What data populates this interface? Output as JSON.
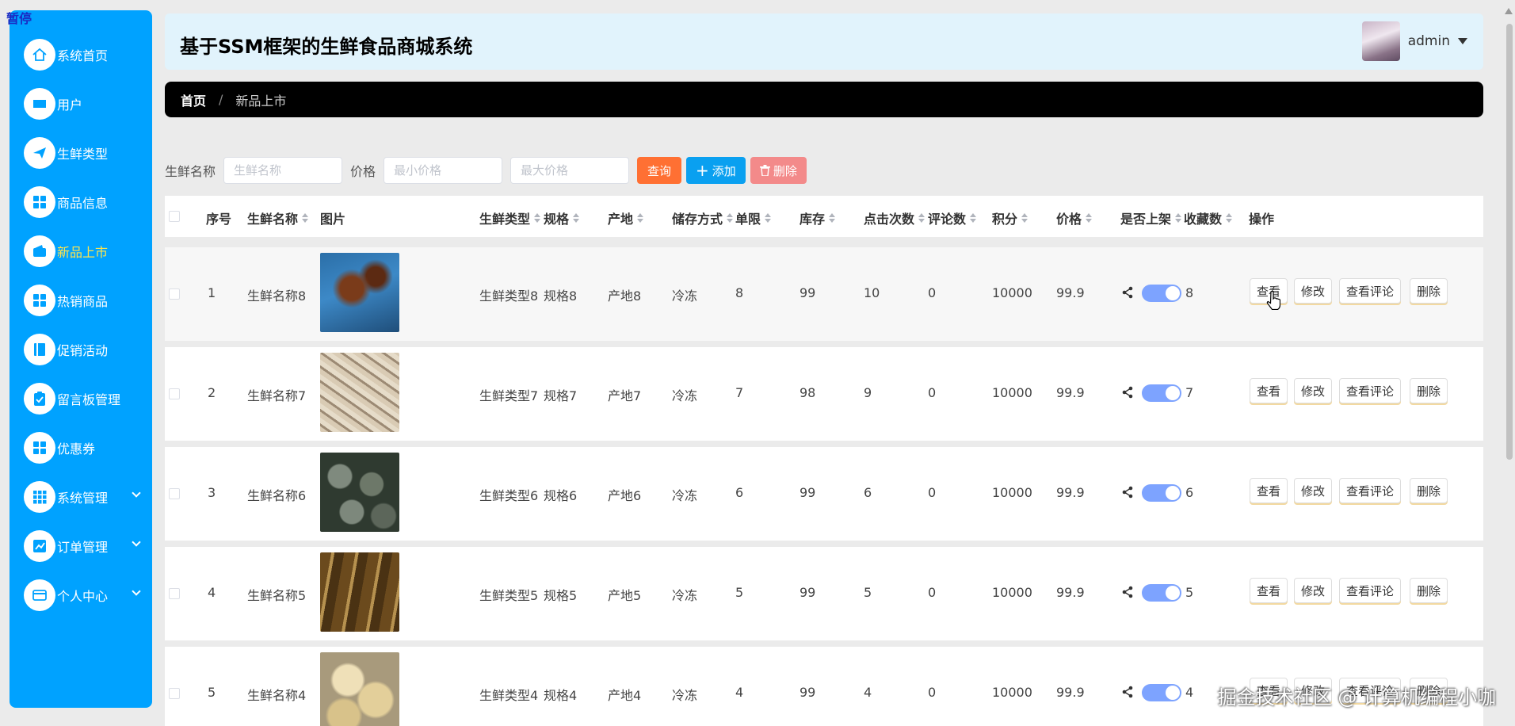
{
  "overlay": {
    "pause": "暂停"
  },
  "sidebar": {
    "items": [
      {
        "label": "系统首页",
        "icon": "home-icon"
      },
      {
        "label": "用户",
        "icon": "user-card-icon"
      },
      {
        "label": "生鲜类型",
        "icon": "paper-plane-icon"
      },
      {
        "label": "商品信息",
        "icon": "grid-icon"
      },
      {
        "label": "新品上市",
        "icon": "wallet-icon",
        "active": true
      },
      {
        "label": "热销商品",
        "icon": "grid-icon"
      },
      {
        "label": "促销活动",
        "icon": "book-icon"
      },
      {
        "label": "留言板管理",
        "icon": "clipboard-icon"
      },
      {
        "label": "优惠券",
        "icon": "grid-icon"
      },
      {
        "label": "系统管理",
        "icon": "apps-icon",
        "expandable": true
      },
      {
        "label": "订单管理",
        "icon": "chart-icon",
        "expandable": true
      },
      {
        "label": "个人中心",
        "icon": "card-icon",
        "expandable": true
      }
    ]
  },
  "header": {
    "title": "基于SSM框架的生鲜食品商城系统",
    "user": "admin"
  },
  "breadcrumb": {
    "home": "首页",
    "sep": "/",
    "current": "新品上市"
  },
  "search": {
    "name_label": "生鲜名称",
    "name_placeholder": "生鲜名称",
    "price_label": "价格",
    "min_placeholder": "最小价格",
    "max_placeholder": "最大价格",
    "query_btn": "查询",
    "add_btn": "添加",
    "delete_btn": "删除"
  },
  "table": {
    "headers": {
      "index": "序号",
      "name": "生鲜名称",
      "image": "图片",
      "type": "生鲜类型",
      "spec": "规格",
      "origin": "产地",
      "storage": "储存方式",
      "limit": "单限",
      "stock": "库存",
      "clicks": "点击次数",
      "comments": "评论数",
      "points": "积分",
      "price": "价格",
      "on_shelf": "是否上架",
      "favorites": "收藏数",
      "actions": "操作"
    },
    "actions": {
      "view": "查看",
      "edit": "修改",
      "view_comments": "查看评论",
      "delete": "删除"
    },
    "rows": [
      {
        "index": "1",
        "name": "生鲜名称8",
        "type": "生鲜类型8",
        "spec": "规格8",
        "origin": "产地8",
        "storage": "冷冻",
        "limit": "8",
        "stock": "99",
        "clicks": "10",
        "comments": "0",
        "points": "10000",
        "price": "99.9",
        "favorites": "8",
        "img": "crab"
      },
      {
        "index": "2",
        "name": "生鲜名称7",
        "type": "生鲜类型7",
        "spec": "规格7",
        "origin": "产地7",
        "storage": "冷冻",
        "limit": "7",
        "stock": "98",
        "clicks": "9",
        "comments": "0",
        "points": "10000",
        "price": "99.9",
        "favorites": "7",
        "img": "shrimp"
      },
      {
        "index": "3",
        "name": "生鲜名称6",
        "type": "生鲜类型6",
        "spec": "规格6",
        "origin": "产地6",
        "storage": "冷冻",
        "limit": "6",
        "stock": "99",
        "clicks": "6",
        "comments": "0",
        "points": "10000",
        "price": "99.9",
        "favorites": "6",
        "img": "snail"
      },
      {
        "index": "4",
        "name": "生鲜名称5",
        "type": "生鲜类型5",
        "spec": "规格5",
        "origin": "产地5",
        "storage": "冷冻",
        "limit": "5",
        "stock": "99",
        "clicks": "5",
        "comments": "0",
        "points": "10000",
        "price": "99.9",
        "favorites": "5",
        "img": "razor-clam"
      },
      {
        "index": "5",
        "name": "生鲜名称4",
        "type": "生鲜类型4",
        "spec": "规格4",
        "origin": "产地4",
        "storage": "冷冻",
        "limit": "4",
        "stock": "99",
        "clicks": "4",
        "comments": "0",
        "points": "10000",
        "price": "99.9",
        "favorites": "4",
        "img": "clam"
      }
    ]
  },
  "watermark": "掘金技术社区 @ 计算机编程小咖",
  "colors": {
    "sidebar": "#00a2ff",
    "accent_active": "#ffe44d",
    "query": "#ff7033",
    "add": "#0aa0f0",
    "delete": "#f38a8a",
    "toggle": "#7da3ff"
  }
}
